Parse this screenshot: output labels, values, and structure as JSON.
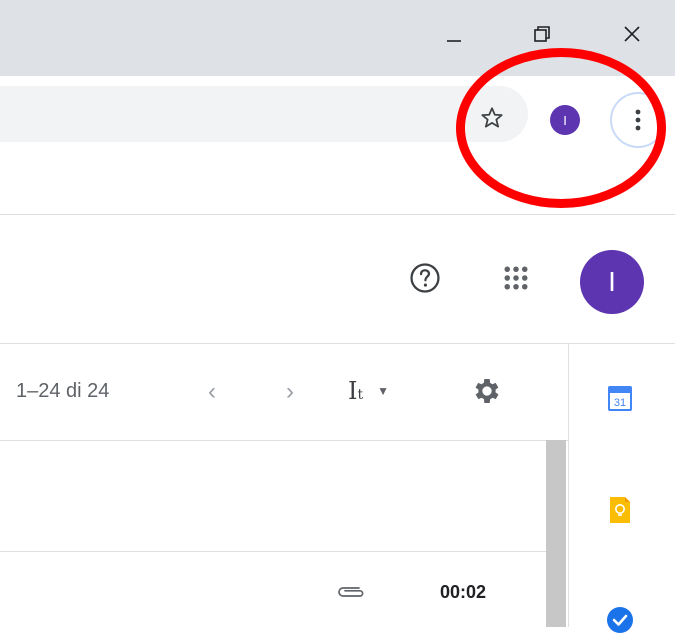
{
  "browser": {
    "profile_initial": "I"
  },
  "gmail": {
    "avatar_initial": "I",
    "pagination": {
      "range_text": "1–24 di 24",
      "prev": "‹",
      "next": "›"
    },
    "density_label": "I",
    "density_sub": "t",
    "calendar_day": "31",
    "rows": [
      {
        "time": "00:02",
        "has_attachment": true
      }
    ]
  },
  "colors": {
    "accent_purple": "#5e35b1",
    "annotation_red": "#ff0000",
    "calendar_blue": "#4285f4",
    "keep_yellow": "#fbbc04",
    "tasks_blue": "#1a73e8"
  },
  "icons": {
    "window": [
      "minimize-icon",
      "restore-icon",
      "close-icon"
    ],
    "toolbar": [
      "star-icon",
      "kebab-menu-icon"
    ],
    "header": [
      "help-icon",
      "apps-grid-icon"
    ],
    "listbar": [
      "chevron-left-icon",
      "chevron-right-icon",
      "density-icon",
      "gear-icon"
    ],
    "side_panel": [
      "calendar-icon",
      "keep-icon",
      "tasks-icon"
    ]
  }
}
